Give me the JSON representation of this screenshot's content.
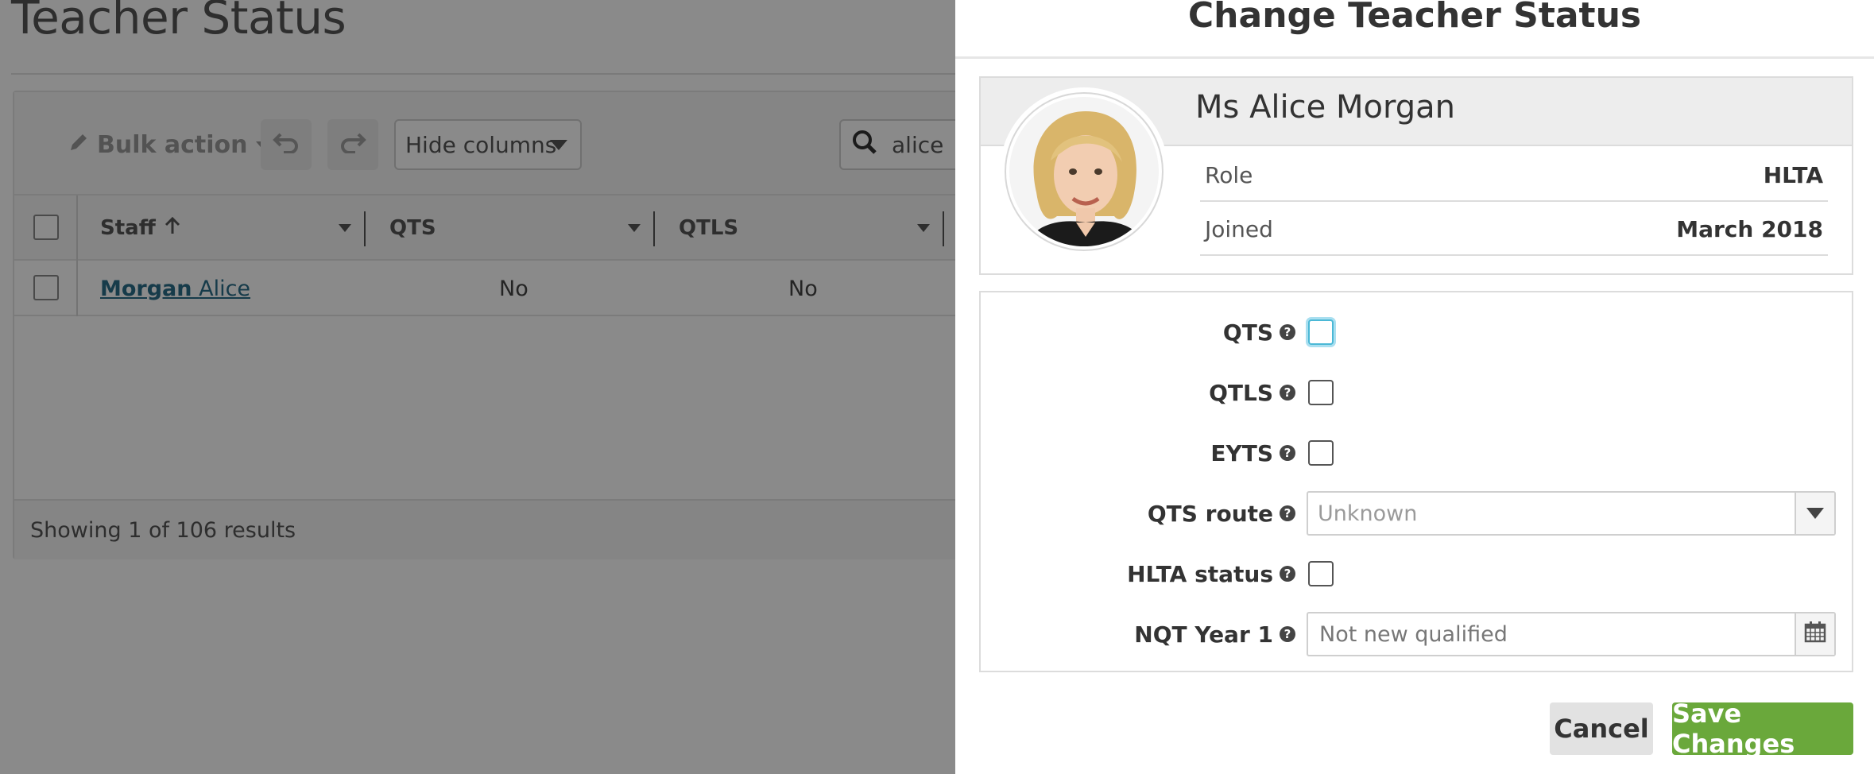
{
  "background": {
    "page_title": "Teacher Status",
    "toolbar": {
      "bulk_action_label": "Bulk action",
      "hide_columns_label": "Hide columns",
      "search_value": "alice"
    },
    "columns": [
      {
        "label": "Staff"
      },
      {
        "label": "QTS"
      },
      {
        "label": "QTLS"
      }
    ],
    "rows": [
      {
        "staff_last": "Morgan",
        "staff_first": "Alice",
        "qts": "No",
        "qtls": "No"
      }
    ],
    "footer_text": "Showing 1 of 106 results"
  },
  "dialog": {
    "title": "Change Teacher Status",
    "profile": {
      "name": "Ms Alice Morgan",
      "role_label": "Role",
      "role_value": "HLTA",
      "joined_label": "Joined",
      "joined_value": "March 2018"
    },
    "fields": {
      "qts": {
        "label": "QTS",
        "checked": false
      },
      "qtls": {
        "label": "QTLS",
        "checked": false
      },
      "eyts": {
        "label": "EYTS",
        "checked": false
      },
      "qts_route": {
        "label": "QTS route",
        "placeholder": "Unknown"
      },
      "hlta_status": {
        "label": "HLTA status",
        "checked": false
      },
      "nqt_year_1": {
        "label": "NQT Year 1",
        "placeholder": "Not new qualified"
      }
    },
    "buttons": {
      "cancel": "Cancel",
      "save": "Save Changes"
    }
  },
  "colors": {
    "save_green": "#6aa83b",
    "link_blue": "#2a6e8a",
    "focus_blue": "#4bb8d6",
    "overlay": "rgba(0,0,0,0.46)"
  },
  "icons": {
    "edit": "pencil-icon",
    "undo": "undo-icon",
    "redo": "redo-icon",
    "search": "search-icon",
    "sort": "arrow-up-icon",
    "help": "question-circle-icon",
    "calendar": "calendar-icon"
  }
}
